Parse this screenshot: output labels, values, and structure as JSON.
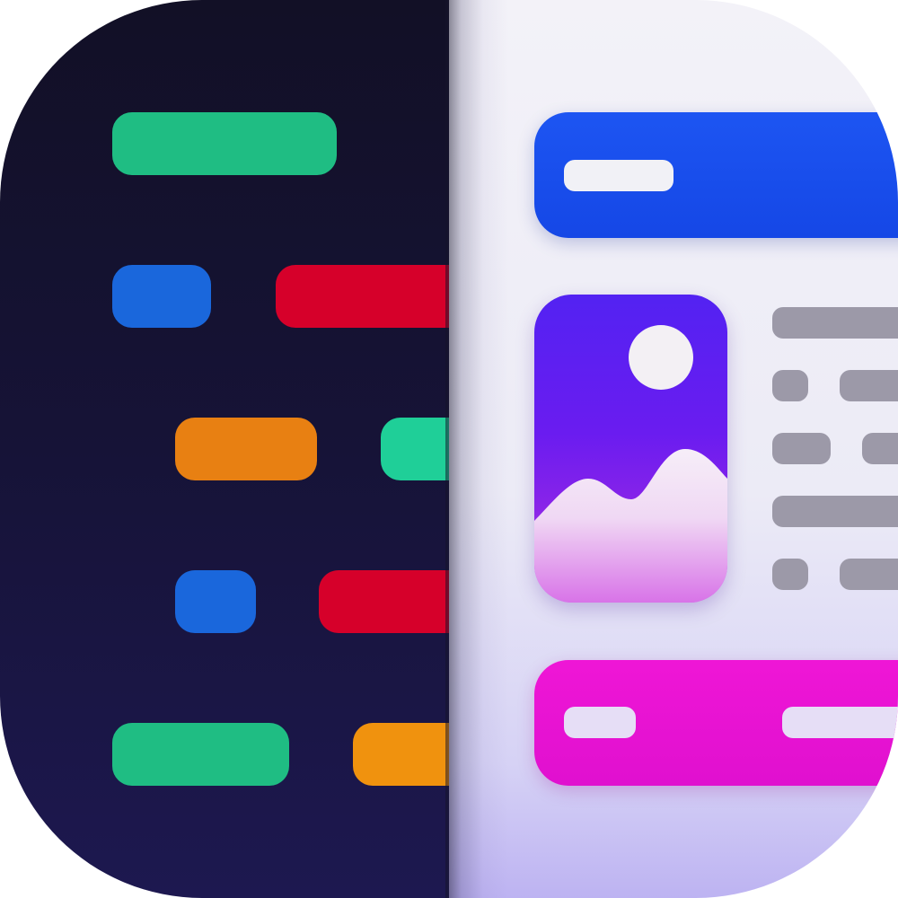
{
  "icon": {
    "colors": {
      "dark_background": "#161337",
      "light_background": "#ecebf6",
      "green": "#1fbd83",
      "blue": "#1a67dc",
      "red": "#d6002a",
      "orange": "#e88012",
      "teal": "#1fcf98",
      "header_blue": "#1547e6",
      "footer_magenta": "#e010cf",
      "image_purple": "#6a1cf0",
      "text_gray": "#9c99a8"
    },
    "code_lines": [
      {
        "name": "code-token-green-1",
        "color": "#1fbd83"
      },
      {
        "name": "code-token-blue-1",
        "color": "#1a67dc"
      },
      {
        "name": "code-token-red-1",
        "color": "#d6002a"
      },
      {
        "name": "code-token-orange-1",
        "color": "#e88012"
      },
      {
        "name": "code-token-teal-1",
        "color": "#1fcf98"
      },
      {
        "name": "code-token-blue-2",
        "color": "#1a67dc"
      },
      {
        "name": "code-token-red-2",
        "color": "#d6002a"
      },
      {
        "name": "code-token-green-2",
        "color": "#1fbd83"
      },
      {
        "name": "code-token-orange-2",
        "color": "#f0920e"
      }
    ],
    "image_icon": "image-placeholder-icon"
  }
}
